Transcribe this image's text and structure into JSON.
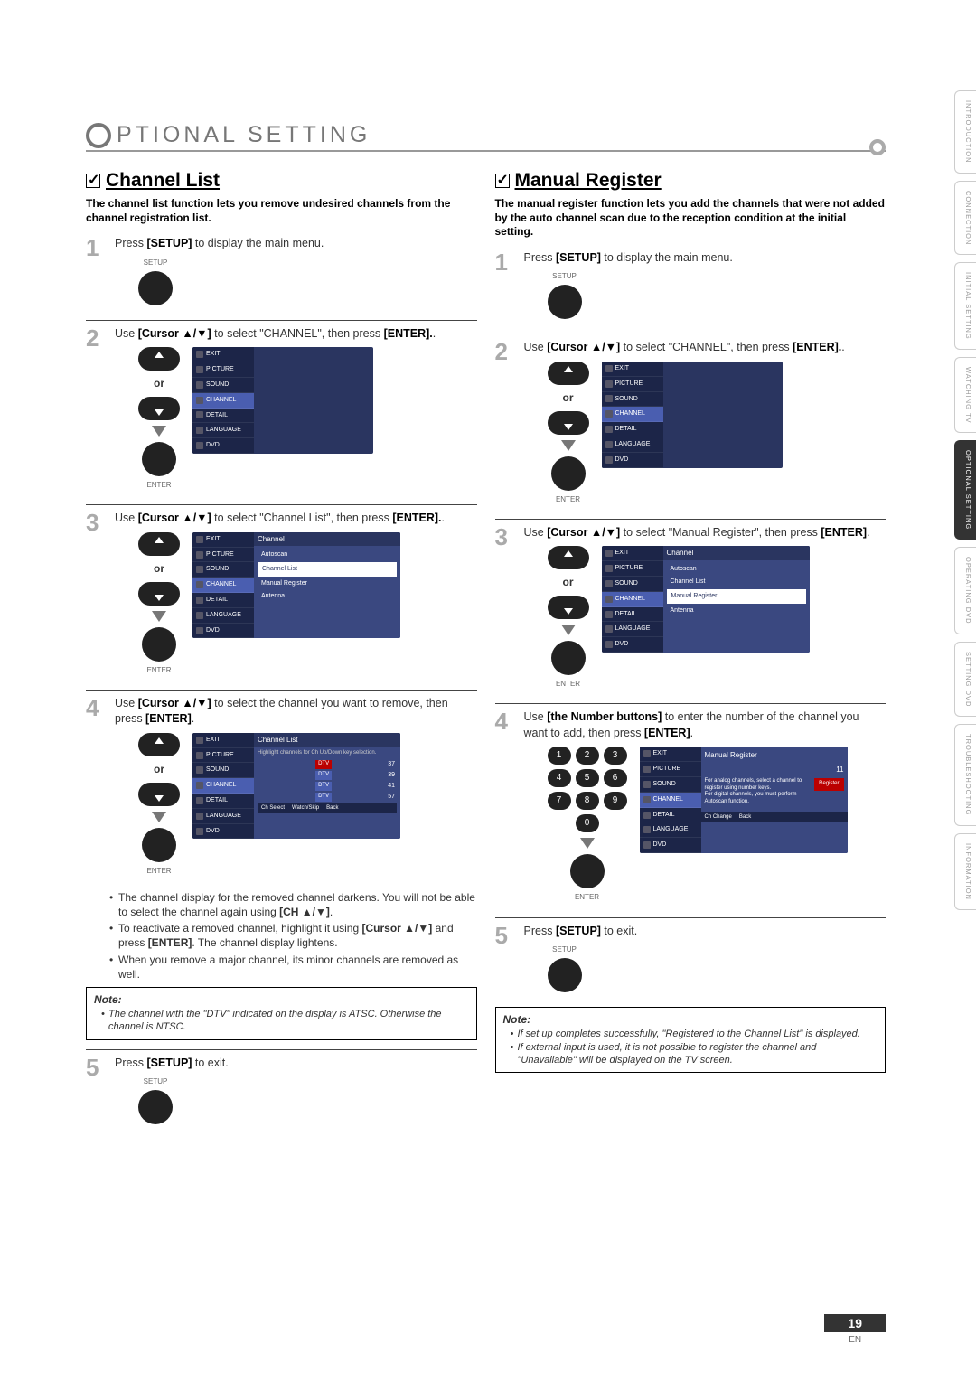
{
  "header": "PTIONAL   SETTING",
  "left": {
    "title": "Channel List",
    "sub": "The channel list function lets you remove undesired channels from the channel registration list.",
    "s1": "Press [SETUP] to display the main menu.",
    "s2a": "Use [Cursor ▲/▼] to select \"CHANNEL\", then press ",
    "s2b": "[ENTER].",
    "s3a": "Use [Cursor ▲/▼] to select \"Channel List\", then press ",
    "s3b": "[ENTER].",
    "s4a": "Use [Cursor ▲/▼] to select the channel you want to remove, then press ",
    "s4b": "[ENTER].",
    "b1": "The channel display for the removed channel darkens. You will not be able to select the channel again using [CH ▲/▼].",
    "b2": "To reactivate a removed channel, highlight it using [Cursor ▲/▼] and press [ENTER]. The channel display lightens.",
    "b3": "When you remove a major channel, its minor channels are removed as well.",
    "note1": "The channel with the \"DTV\" indicated on the display is ATSC. Otherwise the channel is NTSC.",
    "s5": "Press [SETUP] to exit."
  },
  "right": {
    "title": "Manual Register",
    "sub": "The manual register function lets you add the channels that were not added by the auto channel scan due to the reception condition at the initial setting.",
    "s1": "Press [SETUP] to display the main menu.",
    "s2a": "Use [Cursor ▲/▼] to select \"CHANNEL\", then press ",
    "s2b": "[ENTER].",
    "s3a": "Use [Cursor ▲/▼] to select \"Manual Register\", then press ",
    "s3b": "[ENTER].",
    "s4a": "Use [the Number buttons] to enter the number of the channel you want to add, then press ",
    "s4b": "[ENTER].",
    "s5": "Press [SETUP] to exit.",
    "n1": "If set up completes successfully, \"Registered to the Channel List\" is displayed.",
    "n2": "If external input is used, it is not possible to register the channel and \"Unavailable\" will be displayed on the TV screen."
  },
  "labels": {
    "setup": "SETUP",
    "enter": "ENTER",
    "or": "or",
    "note": "Note:"
  },
  "menu": {
    "exit": "EXIT",
    "picture": "PICTURE",
    "sound": "SOUND",
    "channel": "CHANNEL",
    "detail": "DETAIL",
    "language": "LANGUAGE",
    "dvd": "DVD",
    "ch_title": "Channel",
    "autoscan": "Autoscan",
    "chlist": "Channel List",
    "manreg": "Manual Register",
    "antenna": "Antenna",
    "cl_title": "Channel List",
    "cl_hint": "Highlight channels for Ch Up/Down key selection.",
    "mr_title": "Manual Register",
    "mr_txt1": "For analog channels, select a channel to register using number keys.",
    "mr_txt2": "For digital channels, you must perform Autoscan function.",
    "register": "Register",
    "ch11": "11",
    "ft_select": "Ch Select",
    "ft_wd": "Watch/Skip",
    "ft_back": "Back",
    "ft_chchange": "Ch Change"
  },
  "channels": [
    {
      "tag": "DTV",
      "num": "37"
    },
    {
      "tag": "DTV",
      "num": "39"
    },
    {
      "tag": "DTV",
      "num": "41"
    },
    {
      "tag": "DTV",
      "num": "57"
    }
  ],
  "tabs": [
    "INTRODUCTION",
    "CONNECTION",
    "INITIAL SETTING",
    "WATCHING TV",
    "OPTIONAL SETTING",
    "OPERATING DVD",
    "SETTING DVD",
    "TROUBLESHOOTING",
    "INFORMATION"
  ],
  "active_tab": 4,
  "page_num": "19",
  "page_lang": "EN"
}
